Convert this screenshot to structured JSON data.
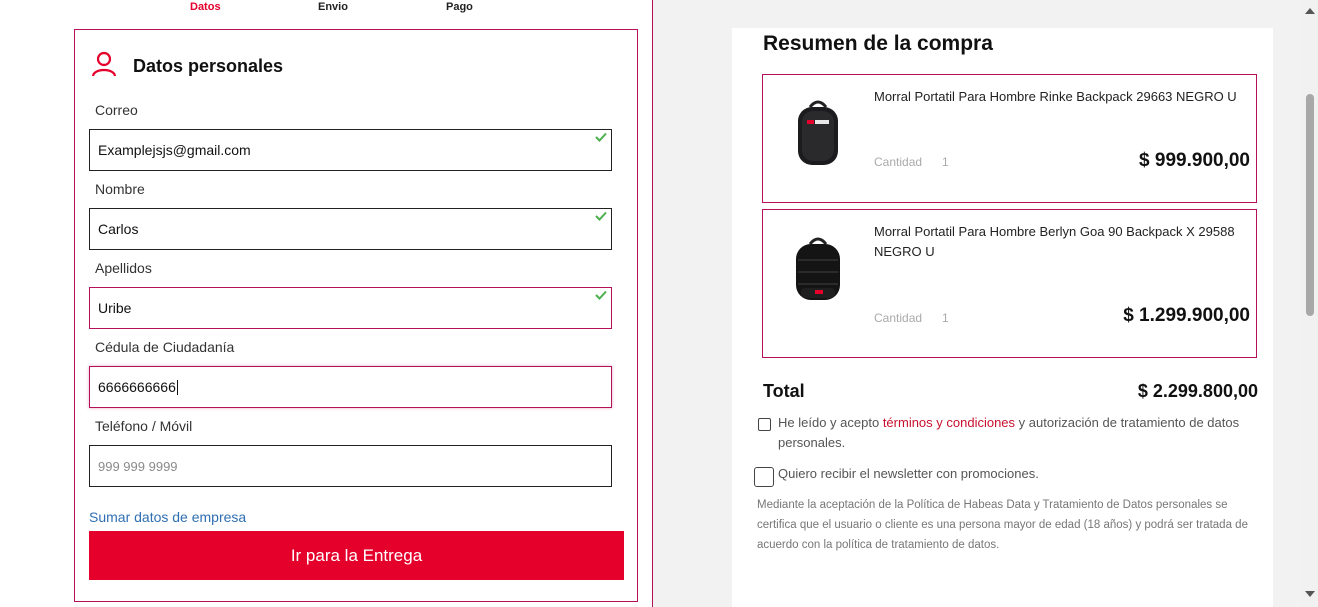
{
  "steps": {
    "items": [
      {
        "label": "Datos",
        "active": true
      },
      {
        "label": "Envio",
        "active": false
      },
      {
        "label": "Pago",
        "active": false
      }
    ]
  },
  "form": {
    "title": "Datos personales",
    "icon": "user-icon",
    "fields": [
      {
        "label": "Correo",
        "value": "Examplejsjs@gmail.com",
        "placeholder": "",
        "valid": true
      },
      {
        "label": "Nombre",
        "value": "Carlos",
        "placeholder": "",
        "valid": true
      },
      {
        "label": "Apellidos",
        "value": "Uribe",
        "placeholder": "",
        "valid": true
      },
      {
        "label": "Cédula de Ciudadanía",
        "value": "6666666666",
        "placeholder": "",
        "valid": false
      },
      {
        "label": "Teléfono / Móvil",
        "value": "",
        "placeholder": "999 999 9999",
        "valid": false
      }
    ],
    "company_link": "Sumar datos de empresa",
    "submit_label": "Ir para la Entrega"
  },
  "summary": {
    "title": "Resumen de la compra",
    "products": [
      {
        "name": "Morral Portatil Para Hombre Rinke Backpack 29663 NEGRO U",
        "qty_label": "Cantidad",
        "qty": "1",
        "price": "$ 999.900,00",
        "image": "backpack-image"
      },
      {
        "name": "Morral Portatil Para Hombre Berlyn Goa 90 Backpack X 29588 NEGRO U",
        "qty_label": "Cantidad",
        "qty": "1",
        "price": "$ 1.299.900,00",
        "image": "backpack-image"
      }
    ],
    "total_label": "Total",
    "total_value": "$ 2.299.800,00",
    "terms_prefix": "He leído y acepto",
    "terms_link": "términos y condiciones",
    "terms_suffix": "y autorización de tratamiento de datos personales.",
    "newsletter": "Quiero recibir el newsletter con promociones.",
    "legal": "Mediante la aceptación de la Política de Habeas Data y Tratamiento de Datos personales se certifica que el usuario o cliente es una persona mayor de edad (18 años) y podrá ser tratada de acuerdo con la política de tratamiento de datos."
  },
  "colors": {
    "accent": "#e4002b",
    "border": "#b3125a",
    "valid": "#4caf50",
    "link": "#2f6fb3"
  }
}
